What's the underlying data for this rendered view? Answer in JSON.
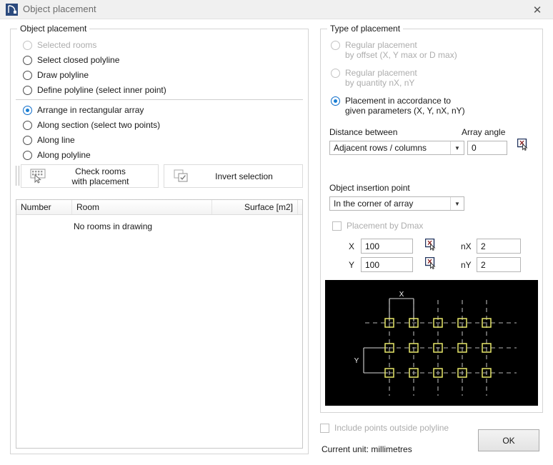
{
  "window": {
    "title": "Object placement",
    "icon": "polyline-corner-icon",
    "close_label": "✕"
  },
  "left_panel": {
    "legend": "Object placement",
    "selection_options": [
      {
        "label": "Selected rooms",
        "checked": false,
        "disabled": true
      },
      {
        "label": "Select closed polyline",
        "checked": false,
        "disabled": false
      },
      {
        "label": "Draw polyline",
        "checked": false,
        "disabled": false
      },
      {
        "label": "Define polyline (select inner point)",
        "checked": false,
        "disabled": false
      }
    ],
    "arrangement_options": [
      {
        "label": "Arrange in rectangular array",
        "checked": true,
        "disabled": false
      },
      {
        "label": "Along section (select two points)",
        "checked": false,
        "disabled": false
      },
      {
        "label": "Along line",
        "checked": false,
        "disabled": false
      },
      {
        "label": "Along polyline",
        "checked": false,
        "disabled": false
      }
    ],
    "buttons": [
      {
        "label": "Check rooms\nwith placement",
        "icon": "select-grid-cursor-icon"
      },
      {
        "label": "Invert selection",
        "icon": "invert-selection-icon"
      }
    ],
    "table": {
      "columns": [
        "Number",
        "Room",
        "Surface [m2]"
      ],
      "empty_message": "No rooms in drawing",
      "rows": []
    }
  },
  "right_panel": {
    "legend": "Type of placement",
    "placement_types": [
      {
        "label": "Regular placement\nby offset (X, Y max or D max)",
        "checked": false,
        "disabled": true
      },
      {
        "label": "Regular placement\nby quantity nX, nY",
        "checked": false,
        "disabled": true
      },
      {
        "label": "Placement in accordance to\ngiven parameters (X, Y, nX, nY)",
        "checked": true,
        "disabled": false
      }
    ],
    "distance_between": {
      "label": "Distance between",
      "value": "Adjacent rows / columns",
      "options": [
        "Adjacent rows / columns"
      ]
    },
    "array_angle": {
      "label": "Array angle",
      "value": "0",
      "pick_icon": "pick-point-icon"
    },
    "insertion_point": {
      "label": "Object insertion point",
      "value": "In the corner of array",
      "options": [
        "In the corner of array"
      ]
    },
    "placement_by_dmax": {
      "label": "Placement by Dmax",
      "checked": false,
      "disabled": true
    },
    "params": [
      {
        "name": "X",
        "value": "100",
        "pick_icon": "pick-point-icon",
        "count_name": "nX",
        "count_value": "2"
      },
      {
        "name": "Y",
        "value": "100",
        "pick_icon": "pick-point-icon",
        "count_name": "nY",
        "count_value": "2"
      }
    ],
    "preview": {
      "alt": "rectangular-array-preview",
      "x_marker": "X",
      "y_marker": "Y",
      "columns": 5,
      "rows": 3,
      "marker_color": "#e8e86a",
      "grid_color": "#b9b9b9",
      "background": "#000000"
    }
  },
  "footer": {
    "include_outside": {
      "label": "Include points outside polyline",
      "checked": false,
      "disabled": true
    },
    "unit_text": "Current unit: millimetres",
    "ok_label": "OK"
  }
}
